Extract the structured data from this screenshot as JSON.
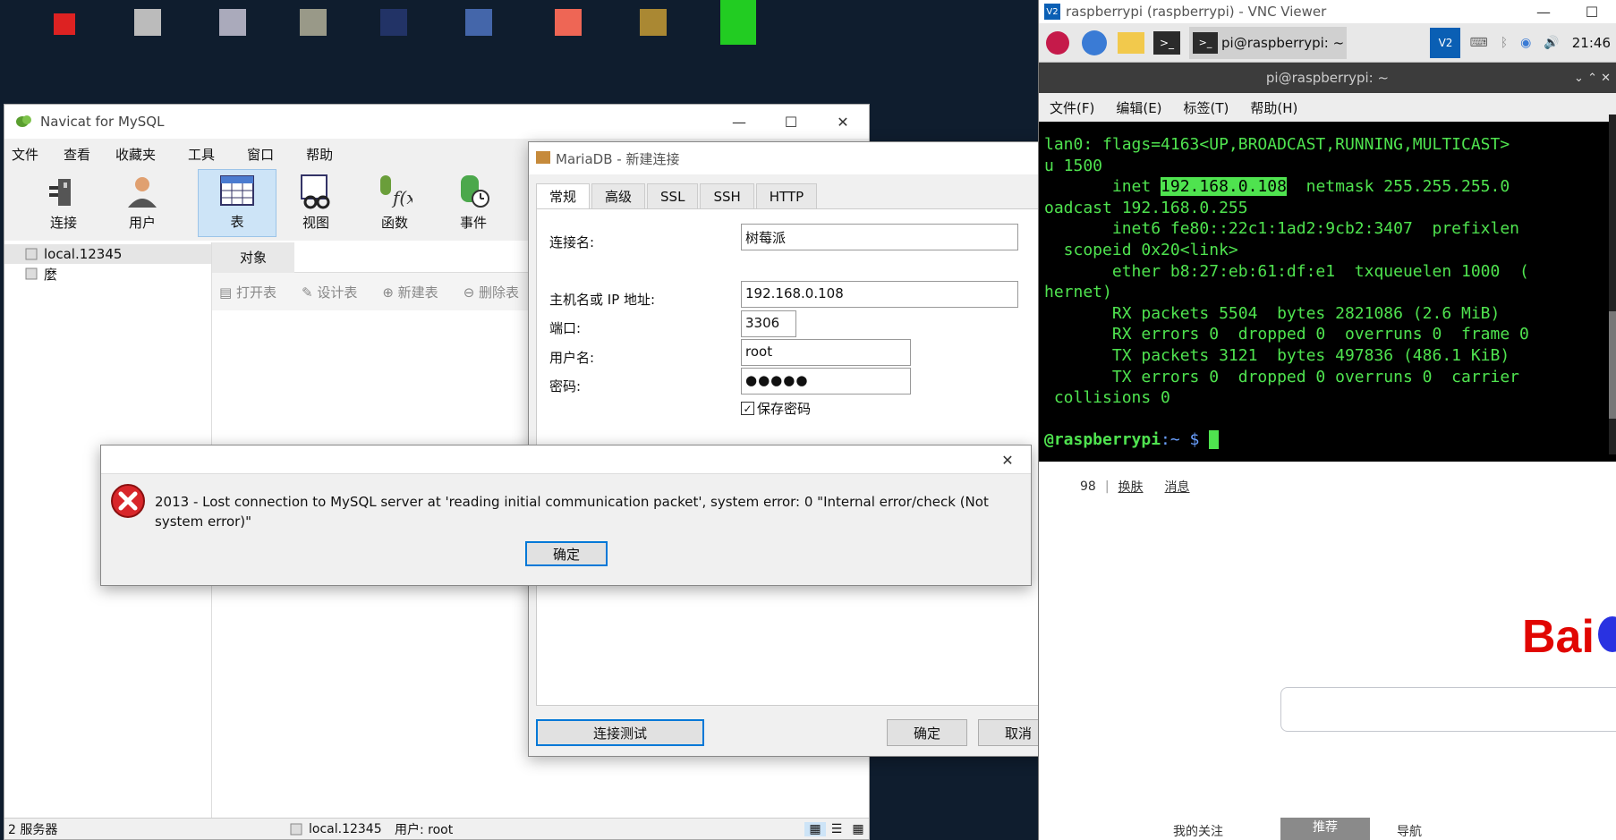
{
  "navicat": {
    "title": "Navicat for MySQL",
    "menu": [
      "文件",
      "查看",
      "收藏夹",
      "工具",
      "窗口",
      "帮助"
    ],
    "toolbar": [
      "连接",
      "用户",
      "表",
      "视图",
      "函数",
      "事件"
    ],
    "tree": [
      "local.12345",
      "麼"
    ],
    "object_tab": "对象",
    "object_actions": [
      "打开表",
      "设计表",
      "新建表",
      "删除表"
    ],
    "status": {
      "servers": "2 服务器",
      "connection": "local.12345",
      "user": "用户: root"
    }
  },
  "dialog": {
    "title": "MariaDB - 新建连接",
    "tabs": [
      "常规",
      "高级",
      "SSL",
      "SSH",
      "HTTP"
    ],
    "labels": {
      "conn_name": "连接名:",
      "host": "主机名或 IP 地址:",
      "port": "端口:",
      "user": "用户名:",
      "password": "密码:",
      "save_pwd": "保存密码"
    },
    "values": {
      "conn_name": "树莓派",
      "host": "192.168.0.108",
      "port": "3306",
      "user": "root",
      "password": "●●●●●"
    },
    "buttons": {
      "test": "连接测试",
      "ok": "确定",
      "cancel": "取消"
    }
  },
  "error": {
    "message": "2013 - Lost connection to MySQL server at 'reading initial communication packet', system error: 0 \"Internal error/check (Not system error)\"",
    "ok": "确定"
  },
  "vnc": {
    "title": "raspberrypi (raspberrypi) - VNC Viewer",
    "taskbar_window": "pi@raspberrypi: ~",
    "clock": "21:46",
    "terminal_title": "pi@raspberrypi: ~",
    "terminal_menu": [
      "文件(F)",
      "编辑(E)",
      "标签(T)",
      "帮助(H)"
    ],
    "terminal": {
      "line1": "lan0: flags=4163<UP,BROADCAST,RUNNING,MULTICAST>",
      "line2": "u 1500",
      "line3_pre": "       inet ",
      "line3_ip": "192.168.0.108",
      "line3_post": "  netmask 255.255.255.0",
      "line4": "oadcast 192.168.0.255",
      "line5": "       inet6 fe80::22c1:1ad2:9cb2:3407  prefixlen",
      " line6": "",
      "line6": "  scopeid 0x20<link>",
      "line7": "       ether b8:27:eb:61:df:e1  txqueuelen 1000  (",
      "line8": "hernet)",
      "line9": "       RX packets 5504  bytes 2821086 (2.6 MiB)",
      "line10": "       RX errors 0  dropped 0  overruns 0  frame 0",
      "line11": "       TX packets 3121  bytes 497836 (486.1 KiB)",
      "line12": "       TX errors 0  dropped 0 overruns 0  carrier",
      "line13": " collisions 0",
      "prompt": "@raspberrypi",
      "prompt_tail": ":~ $ "
    },
    "browser": {
      "count": "98",
      "links": [
        "换肤",
        "消息"
      ],
      "logo": "Bai",
      "bottom": [
        "我的关注",
        "推荐",
        "导航"
      ]
    }
  }
}
